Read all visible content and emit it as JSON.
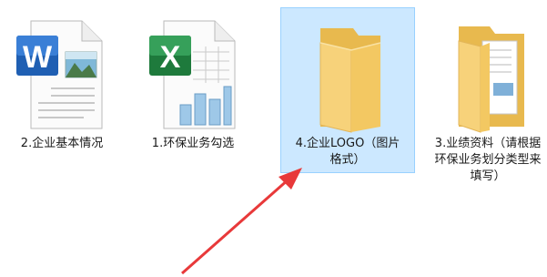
{
  "files": [
    {
      "label": "2.企业基本情况",
      "icon": "word-document-icon"
    },
    {
      "label": "1.环保业务勾选",
      "icon": "excel-spreadsheet-icon"
    },
    {
      "label": "4.企业LOGO（图片\n格式）",
      "icon": "folder-icon",
      "selected": true
    },
    {
      "label": "3.业绩资料（请根据\n环保业务划分类型来\n填写）",
      "icon": "folder-with-files-icon"
    }
  ],
  "colors": {
    "selection_bg": "#cce8ff",
    "selection_border": "#99d1ff",
    "arrow": "#e8393a",
    "folder": "#f7d27a"
  }
}
